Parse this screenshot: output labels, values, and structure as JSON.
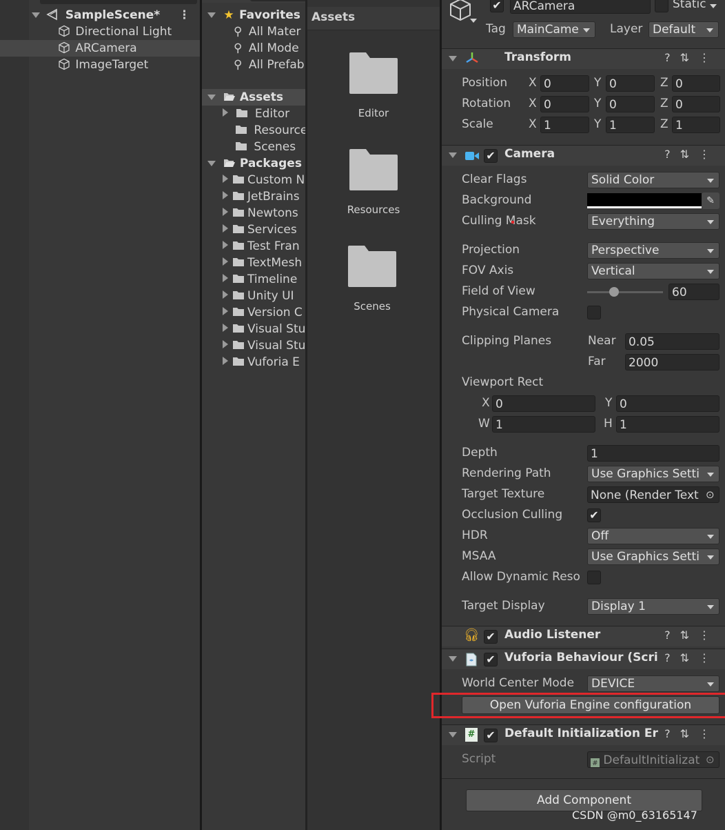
{
  "hierarchy": {
    "scene_name": "SampleScene*",
    "items": [
      {
        "label": "Directional Light"
      },
      {
        "label": "ARCamera"
      },
      {
        "label": "ImageTarget"
      }
    ]
  },
  "project": {
    "favorites_label": "Favorites",
    "favorites": [
      {
        "label": "All Mater"
      },
      {
        "label": "All Mode"
      },
      {
        "label": "All Prefab"
      }
    ],
    "assets_label": "Assets",
    "assets": [
      {
        "label": "Editor"
      },
      {
        "label": "Resource"
      },
      {
        "label": "Scenes"
      }
    ],
    "packages_label": "Packages",
    "packages": [
      {
        "label": "Custom N"
      },
      {
        "label": "JetBrains"
      },
      {
        "label": "Newtons"
      },
      {
        "label": "Services"
      },
      {
        "label": "Test Fran"
      },
      {
        "label": "TextMesh"
      },
      {
        "label": "Timeline"
      },
      {
        "label": "Unity UI"
      },
      {
        "label": "Version C"
      },
      {
        "label": "Visual Stu"
      },
      {
        "label": "Visual Stu"
      },
      {
        "label": "Vuforia E"
      }
    ],
    "toolbar_count": "12"
  },
  "asset_grid": {
    "title": "Assets",
    "folders": [
      {
        "label": "Editor"
      },
      {
        "label": "Resources"
      },
      {
        "label": "Scenes"
      }
    ]
  },
  "inspector": {
    "object_name": "ARCamera",
    "static_label": "Static",
    "tag_label": "Tag",
    "tag_value": "MainCame",
    "layer_label": "Layer",
    "layer_value": "Default",
    "transform": {
      "title": "Transform",
      "position_label": "Position",
      "rotation_label": "Rotation",
      "scale_label": "Scale",
      "axis_x": "X",
      "axis_y": "Y",
      "axis_z": "Z",
      "position": [
        "0",
        "0",
        "0"
      ],
      "rotation": [
        "0",
        "0",
        "0"
      ],
      "scale": [
        "1",
        "1",
        "1"
      ]
    },
    "camera": {
      "title": "Camera",
      "clear_flags_label": "Clear Flags",
      "clear_flags_value": "Solid Color",
      "background_label": "Background",
      "background_color": "#000000",
      "culling_mask_label": "Culling Mask",
      "culling_mask_value": "Everything",
      "projection_label": "Projection",
      "projection_value": "Perspective",
      "fov_axis_label": "FOV Axis",
      "fov_axis_value": "Vertical",
      "fov_label": "Field of View",
      "fov_value": "60",
      "fov_slider_fraction": 0.35,
      "physical_camera_label": "Physical Camera",
      "clipping_label": "Clipping Planes",
      "near_label": "Near",
      "near_value": "0.05",
      "far_label": "Far",
      "far_value": "2000",
      "viewport_label": "Viewport Rect",
      "vp_x_label": "X",
      "vp_x": "0",
      "vp_y_label": "Y",
      "vp_y": "0",
      "vp_w_label": "W",
      "vp_w": "1",
      "vp_h_label": "H",
      "vp_h": "1",
      "depth_label": "Depth",
      "depth_value": "1",
      "rendering_path_label": "Rendering Path",
      "rendering_path_value": "Use Graphics Setti",
      "target_texture_label": "Target Texture",
      "target_texture_value": "None (Render Text",
      "occlusion_label": "Occlusion Culling",
      "hdr_label": "HDR",
      "hdr_value": "Off",
      "msaa_label": "MSAA",
      "msaa_value": "Use Graphics Setti",
      "dynamic_res_label": "Allow Dynamic Reso",
      "target_display_label": "Target Display",
      "target_display_value": "Display 1"
    },
    "audio_listener_title": "Audio Listener",
    "vuforia": {
      "title": "Vuforia Behaviour (Scrip",
      "world_center_label": "World Center Mode",
      "world_center_value": "DEVICE",
      "open_config_button": "Open Vuforia Engine configuration"
    },
    "default_init": {
      "title": "Default Initialization Erro",
      "script_label": "Script",
      "script_value": "DefaultInitializat"
    },
    "add_component": "Add Component"
  },
  "watermark": "CSDN @m0_63165147",
  "colors": {
    "highlight_box": "#e0272b",
    "favorite_star": "#f4c430"
  }
}
